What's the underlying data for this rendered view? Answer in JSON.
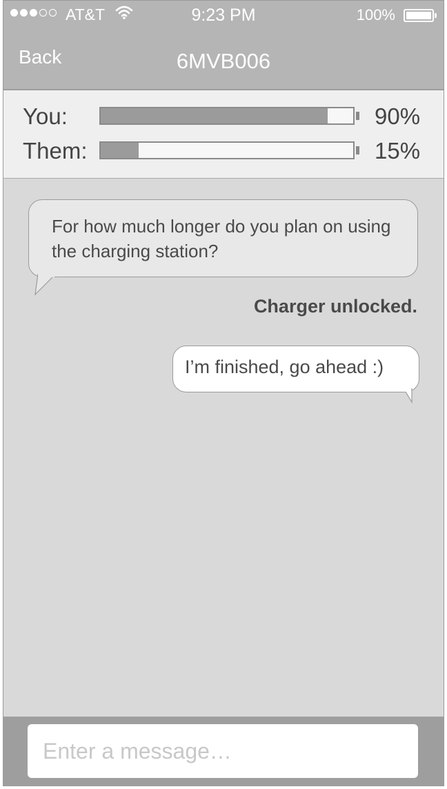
{
  "status_bar": {
    "signal_full": 3,
    "signal_empty": 2,
    "carrier": "AT&T",
    "time": "9:23 PM",
    "battery_percent": "100%",
    "battery_level": 1.0
  },
  "nav": {
    "back_label": "Back",
    "title": "6MVB006"
  },
  "charge": {
    "you": {
      "label": "You:",
      "value_text": "90%",
      "level": 0.9
    },
    "them": {
      "label": "Them:",
      "value_text": "15%",
      "level": 0.15
    }
  },
  "chat": {
    "incoming_message": "For how much longer do you plan on using the charging station?",
    "system_message": "Charger unlocked.",
    "outgoing_message": "I’m finished, go ahead :)"
  },
  "composer": {
    "placeholder": "Enter a message…",
    "value": ""
  },
  "colors": {
    "header_bg": "#b5b5b5",
    "chat_bg": "#d9d9d9",
    "panel_bg": "#efefef",
    "bar_fill": "#9b9b9b",
    "input_bar_bg": "#9e9e9e"
  }
}
